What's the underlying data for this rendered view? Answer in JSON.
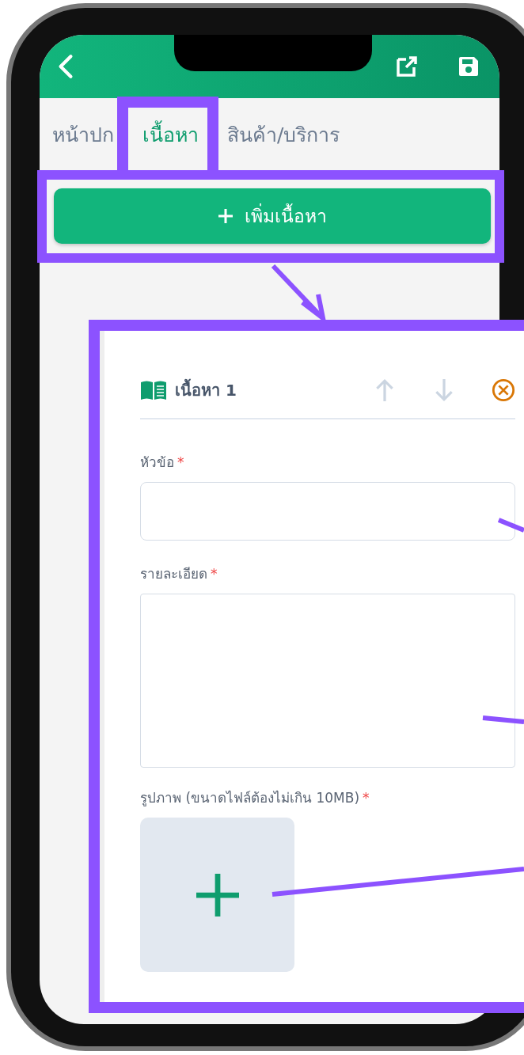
{
  "tabs": [
    {
      "label": "หน้าปก",
      "selected": false
    },
    {
      "label": "เนื้อหา",
      "selected": true
    },
    {
      "label": "สินค้า/บริการ",
      "selected": false
    }
  ],
  "add_button": {
    "label": "เพิ่มเนื้อหา"
  },
  "card": {
    "title": "เนื้อหา 1",
    "fields": [
      {
        "kind": "input",
        "label": "หัวข้อ",
        "mark": "*"
      },
      {
        "kind": "textarea",
        "label": "รายละเอียด",
        "mark": "*"
      },
      {
        "kind": "image",
        "label": "รูปภาพ (ขนาดไฟล์ต้องไม่เกิน 10MB)",
        "mark": "*"
      }
    ]
  }
}
